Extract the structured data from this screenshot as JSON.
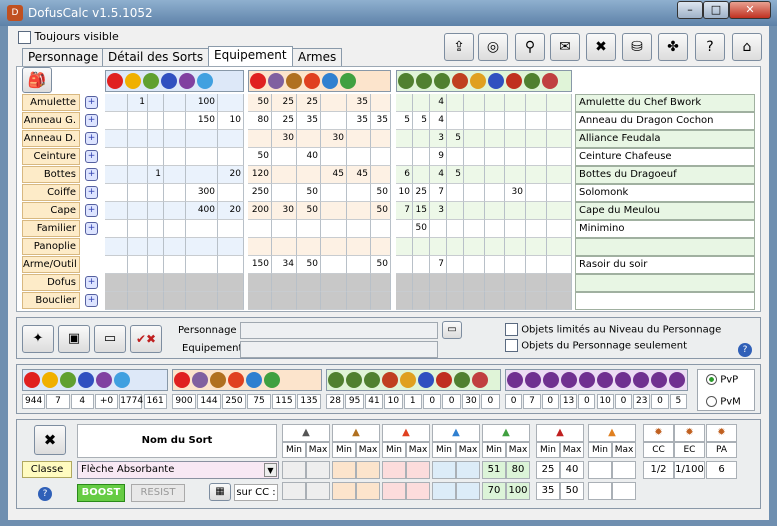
{
  "window": {
    "title": "DofusCalc v1.5.1052",
    "min": "–",
    "max": "□",
    "close": "✕",
    "app_icon": "D"
  },
  "always_visible": "Toujours visible",
  "tabs": [
    "Personnage",
    "Détail des Sorts",
    "Equipement",
    "Armes"
  ],
  "toolbar_icons": [
    "export-icon",
    "globe-icon",
    "magnifier-icon",
    "scroll-icon",
    "tools-icon",
    "bag-icon",
    "puzzle-icon",
    "help-icon",
    "door-icon"
  ],
  "toolbar_glyphs": [
    "⇪",
    "◎",
    "⚲",
    "✉",
    "✖",
    "⛁",
    "✤",
    "?",
    "⌂"
  ],
  "slots": [
    {
      "label": "Amulette",
      "plus": true,
      "item": "Amulette du Chef Bwork",
      "a": [
        "",
        "1",
        "",
        "",
        "100",
        ""
      ],
      "b": [
        "50",
        "25",
        "25",
        "",
        "35",
        ""
      ],
      "c": [
        "",
        "",
        "4",
        "",
        "",
        "",
        "",
        "",
        ""
      ]
    },
    {
      "label": "Anneau G.",
      "plus": true,
      "item": "Anneau du Dragon Cochon",
      "a": [
        "",
        "",
        "",
        "",
        "150",
        "10"
      ],
      "b": [
        "80",
        "25",
        "35",
        "",
        "35",
        "35"
      ],
      "c": [
        "5",
        "5",
        "4",
        "",
        "",
        "",
        "",
        "",
        ""
      ]
    },
    {
      "label": "Anneau D.",
      "plus": true,
      "item": "Alliance Feudala",
      "a": [
        "",
        "",
        "",
        "",
        "",
        ""
      ],
      "b": [
        "",
        "30",
        "",
        "30",
        "",
        ""
      ],
      "c": [
        "",
        "",
        "3",
        "5",
        "",
        "",
        "",
        "",
        ""
      ]
    },
    {
      "label": "Ceinture",
      "plus": true,
      "item": "Ceinture Chafeuse",
      "a": [
        "",
        "",
        "",
        "",
        "",
        ""
      ],
      "b": [
        "50",
        "",
        "40",
        "",
        "",
        ""
      ],
      "c": [
        "",
        "",
        "9",
        "",
        "",
        "",
        "",
        "",
        ""
      ]
    },
    {
      "label": "Bottes",
      "plus": true,
      "item": "Bottes du Dragoeuf",
      "a": [
        "",
        "",
        "1",
        "",
        "",
        "20"
      ],
      "b": [
        "120",
        "",
        "",
        "45",
        "45",
        ""
      ],
      "c": [
        "6",
        "",
        "4",
        "5",
        "",
        "",
        "",
        "",
        ""
      ]
    },
    {
      "label": "Coiffe",
      "plus": true,
      "item": "Solomonk",
      "a": [
        "",
        "",
        "",
        "",
        "300",
        ""
      ],
      "b": [
        "250",
        "",
        "50",
        "",
        "",
        "50"
      ],
      "c": [
        "10",
        "25",
        "7",
        "",
        "",
        "",
        "30",
        "",
        ""
      ]
    },
    {
      "label": "Cape",
      "plus": true,
      "item": "Cape du Meulou",
      "a": [
        "",
        "",
        "",
        "",
        "400",
        "20"
      ],
      "b": [
        "200",
        "30",
        "50",
        "",
        "",
        "50"
      ],
      "c": [
        "7",
        "15",
        "3",
        "",
        "",
        "",
        "",
        "",
        ""
      ]
    },
    {
      "label": "Familier",
      "plus": true,
      "item": "Minimino",
      "a": [
        "",
        "",
        "",
        "",
        "",
        ""
      ],
      "b": [
        "",
        "",
        "",
        "",
        "",
        ""
      ],
      "c": [
        "",
        "50",
        "",
        "",
        "",
        "",
        "",
        "",
        ""
      ]
    },
    {
      "label": "Panoplie",
      "plus": false,
      "item": "",
      "a": [
        "",
        "",
        "",
        "",
        "",
        ""
      ],
      "b": [
        "",
        "",
        "",
        "",
        "",
        ""
      ],
      "c": [
        "",
        "",
        "",
        "",
        "",
        "",
        "",
        "",
        ""
      ]
    },
    {
      "label": "Arme/Outil",
      "plus": false,
      "item": "Rasoir du soir",
      "a": [
        "",
        "",
        "",
        "",
        "",
        ""
      ],
      "b": [
        "150",
        "34",
        "50",
        "",
        "",
        "50"
      ],
      "c": [
        "",
        "",
        "7",
        "",
        "",
        "",
        "",
        "",
        ""
      ]
    },
    {
      "label": "Dofus",
      "plus": true,
      "item": "",
      "a": [
        "",
        "",
        "",
        "",
        "",
        ""
      ],
      "b": [
        "",
        "",
        "",
        "",
        "",
        ""
      ],
      "c": [
        "",
        "",
        "",
        "",
        "",
        "",
        "",
        "",
        ""
      ]
    },
    {
      "label": "Bouclier",
      "plus": true,
      "item": "",
      "a": [
        "",
        "",
        "",
        "",
        "",
        ""
      ],
      "b": [
        "",
        "",
        "",
        "",
        "",
        ""
      ],
      "c": [
        "",
        "",
        "",
        "",
        "",
        "",
        "",
        "",
        ""
      ]
    }
  ],
  "group_a_icons": [
    "heart-icon",
    "star-icon",
    "broom-icon",
    "plane-icon",
    "arrow-circle-icon",
    "circle-icon"
  ],
  "group_b_icons": [
    "heart-icon",
    "wheel-icon",
    "earth-icon",
    "fire-icon",
    "water-icon",
    "air-icon"
  ],
  "group_c_icons": [
    "plus-sword-icon",
    "plus-percent-icon",
    "plus-cc-icon",
    "plus-heal-icon",
    "gear-icon",
    "shield-blue-icon",
    "shield-red-icon",
    "plus-dagger-icon",
    "percent-icon"
  ],
  "profile": {
    "personnage_label": "Personnage",
    "equipement_label": "Equipement",
    "limit_level": "Objets limités au Niveau du Personnage",
    "perso_only": "Objets du Personnage seulement"
  },
  "totals": {
    "a": [
      "944",
      "7",
      "4",
      "+0",
      "1774",
      "161"
    ],
    "b": [
      "900",
      "144",
      "250",
      "75",
      "115",
      "135"
    ],
    "c": [
      "28",
      "95",
      "41",
      "10",
      "1",
      "0",
      "0",
      "30",
      "0"
    ],
    "d": [
      "0",
      "7",
      "0",
      "13",
      "0",
      "10",
      "0",
      "23",
      "0",
      "5"
    ]
  },
  "mode": {
    "pvp": "PvP",
    "pvm": "PvM",
    "selected": "PvP"
  },
  "spell": {
    "header": "Nom du Sort",
    "classe": "Classe",
    "selected": "Flèche Absorbante",
    "boost": "BOOST",
    "resist": "RESIST",
    "sur_cc": "sur CC :",
    "min": "Min",
    "max": "Max",
    "cc": "CC",
    "ec": "EC",
    "pa": "PA",
    "row1": {
      "air": [
        "51",
        "80"
      ],
      "vol": [
        "25",
        "40"
      ],
      "cc": "1/2",
      "ec": "1/100",
      "pa": "6"
    },
    "row2": {
      "air": [
        "70",
        "100"
      ],
      "vol": [
        "35",
        "50"
      ]
    }
  }
}
